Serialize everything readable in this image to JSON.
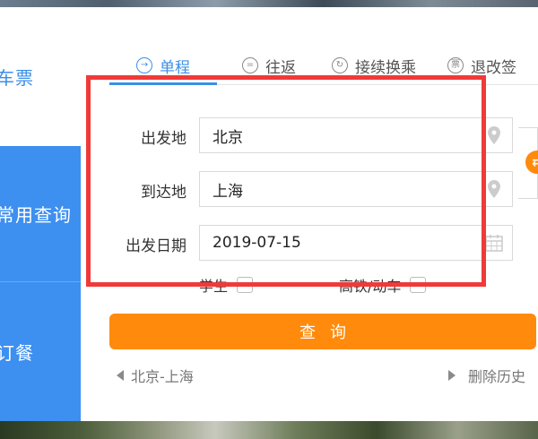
{
  "nav": {
    "items": [
      {
        "label": "车票",
        "active": false
      },
      {
        "label": "常用查询",
        "active": true
      },
      {
        "label": "订餐",
        "active": false
      }
    ]
  },
  "tabs": [
    {
      "label": "单程",
      "icon": "arrow-right-circle-icon",
      "glyph": "→",
      "active": true
    },
    {
      "label": "往返",
      "icon": "equals-circle-icon",
      "glyph": "=",
      "active": false
    },
    {
      "label": "接续换乘",
      "icon": "cycle-circle-icon",
      "glyph": "↻",
      "active": false
    },
    {
      "label": "退改签",
      "icon": "ticket-circle-icon",
      "glyph": "票",
      "active": false
    }
  ],
  "form": {
    "from_label": "出发地",
    "from_value": "北京",
    "to_label": "到达地",
    "to_value": "上海",
    "date_label": "出发日期",
    "date_value": "2019-07-15",
    "student_label": "学生",
    "highspeed_label": "高铁/动车",
    "query_label": "查询"
  },
  "history": {
    "item": "北京-上海",
    "clear_label": "删除历史"
  },
  "colors": {
    "primary_blue": "#3d8ff0",
    "accent_orange": "#ff8a0b",
    "annotation_red": "#f03a3a"
  }
}
